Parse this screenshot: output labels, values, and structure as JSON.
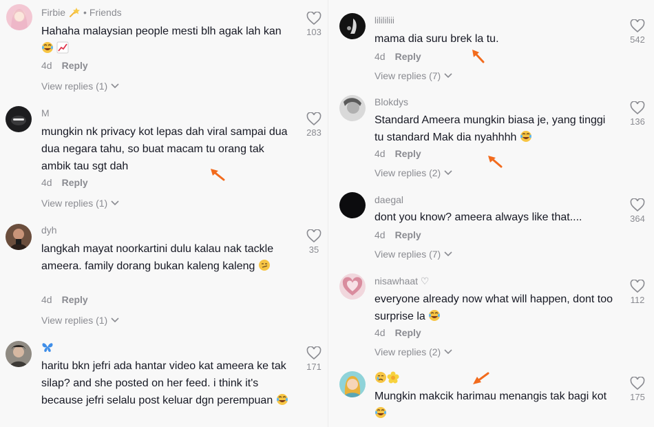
{
  "colors": {
    "panel_bg": "#f8f8f8",
    "text": "#161823",
    "muted": "#8a8b91",
    "annotation_arrow": "#f26b1d"
  },
  "left": {
    "comments": [
      {
        "username": "Firbie",
        "username_icon": "shooting-star-icon",
        "badge": "Friends",
        "text": "Hahaha malaysian people mesti blh agak lah kan",
        "text_icons": [
          "laughing-crying-emoji",
          "chart-up-emoji"
        ],
        "time": "4d",
        "reply": "Reply",
        "view_replies": "View replies (1)",
        "likes": "103"
      },
      {
        "username": "M",
        "text": "mungkin nk privacy kot lepas dah viral sampai dua dua negara tahu, so buat macam tu orang tak ambik tau sgt dah",
        "time": "4d",
        "reply": "Reply",
        "view_replies": "View replies (1)",
        "likes": "283"
      },
      {
        "username": "dyh",
        "text": "langkah mayat noorkartini dulu kalau nak tackle ameera. family dorang bukan kaleng kaleng",
        "text_icons": [
          "smirk-emoji"
        ],
        "time": "4d",
        "reply": "Reply",
        "view_replies": "View replies (1)",
        "likes": "35"
      },
      {
        "username_icon": "butterfly-icon",
        "text": "haritu bkn jefri ada hantar video kat ameera ke tak silap? and she posted on her feed. i think it's because jefri selalu post keluar dgn perempuan",
        "text_icons": [
          "laughing-crying-emoji"
        ],
        "likes": "171"
      }
    ]
  },
  "right": {
    "comments": [
      {
        "username": "lilililiii",
        "text": "mama dia suru brek la tu.",
        "time": "4d",
        "reply": "Reply",
        "view_replies": "View replies (7)",
        "likes": "542"
      },
      {
        "username": "Blokdys",
        "text": "Standard Ameera mungkin biasa je, yang tinggi tu standard Mak dia nyahhhh",
        "text_icons": [
          "laughing-crying-emoji"
        ],
        "time": "4d",
        "reply": "Reply",
        "view_replies": "View replies (2)",
        "likes": "136"
      },
      {
        "username": "daegal",
        "text": "dont you know? ameera always like that....",
        "time": "4d",
        "reply": "Reply",
        "view_replies": "View replies (7)",
        "likes": "364"
      },
      {
        "username": "nisawhaat ♡",
        "text": "everyone already now what will happen, dont too surprise la",
        "text_icons": [
          "laughing-crying-emoji"
        ],
        "time": "4d",
        "reply": "Reply",
        "view_replies": "View replies (2)",
        "likes": "112"
      },
      {
        "username_icons": [
          "crying-face-emoji",
          "blossom-emoji"
        ],
        "text": "Mungkin makcik harimau menangis tak bagi kot",
        "text_icons": [
          "laughing-crying-emoji"
        ],
        "likes": "175"
      }
    ]
  }
}
